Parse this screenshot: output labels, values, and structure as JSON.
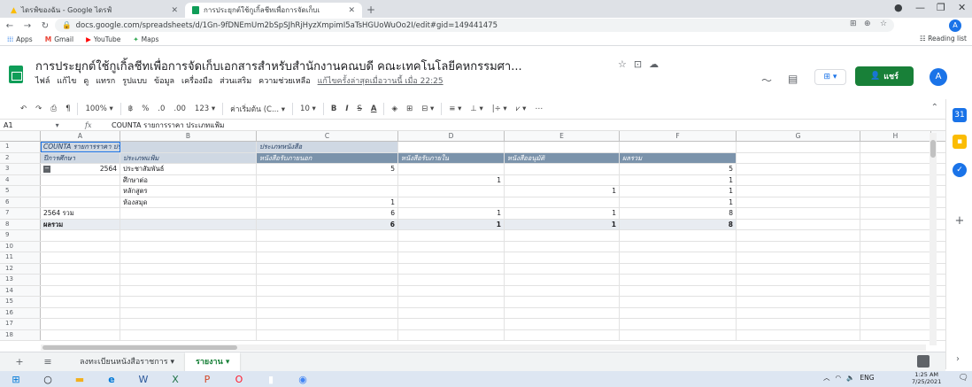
{
  "browser": {
    "tabs": [
      {
        "title": "ไดรฟ์ของฉัน - Google ไดรฟ์",
        "icon": "google-drive-icon",
        "color": "#fbbc04"
      },
      {
        "title": "การประยุกต์ใช้กูเกิ้ลชีทเพื่อการจัดเก็บเ",
        "icon": "google-sheets-icon",
        "color": "#0f9d58"
      }
    ],
    "new_tab": "+",
    "minimize": "—",
    "maximize": "❐",
    "close": "✕",
    "url": "docs.google.com/spreadsheets/d/1Gn-9fDNEmUm2bSpSJhRjHyzXmpimI5aTsHGUoWuOo2I/edit#gid=149441475",
    "profile": "A",
    "bookmarks": [
      "Apps",
      "Gmail",
      "YouTube",
      "Maps"
    ],
    "reading_list": "Reading list"
  },
  "sheets": {
    "title": "การประยุกต์ใช้กูเกิ้ลชีทเพื่อการจัดเก็บเอกสารสำหรับสำนักงานคณบดี คณะเทคโนโลยีคหกรรมศา...",
    "menus": [
      "ไฟล์",
      "แก้ไข",
      "ดู",
      "แทรก",
      "รูปแบบ",
      "ข้อมูล",
      "เครื่องมือ",
      "ส่วนเสริม",
      "ความช่วยเหลือ"
    ],
    "last_edit": "แก้ไขครั้งล่าสุดเมื่อวานนี้ เมื่อ 22:25",
    "share_label": "แชร์",
    "account": "A",
    "present_label": "⊞ ▾",
    "accent": "#188038"
  },
  "toolbar": {
    "zoom": "100%",
    "currency": "฿",
    "percent": "%",
    "decimal_decrease": ".0",
    "decimal_increase": ".00",
    "number_format": "123",
    "font": "ค่าเริ่มต้น (C...",
    "font_size": "10",
    "more": "⋯"
  },
  "formula_bar": {
    "cell_ref": "A1",
    "fx": "fx",
    "content": "COUNTA รายการราคา ประเภทแฟ้ม"
  },
  "grid": {
    "columns": [
      "A",
      "B",
      "C",
      "D",
      "E",
      "F",
      "G",
      "H"
    ],
    "rows": [
      [
        "COUNTA รายการราคา ประเภทแฟ้ม",
        "",
        "ประเภทหนังสือ",
        "",
        "",
        "",
        "",
        ""
      ],
      [
        "ปีการศึกษา",
        "ประเภทแฟ้ม",
        "หนังสือรับภายนอก",
        "หนังสือรับภายใน",
        "หนังสืออนุมัติ",
        "ผลรวม",
        "",
        ""
      ],
      [
        "2564",
        "ประชาสัมพันธ์",
        "5",
        "",
        "",
        "5",
        "",
        ""
      ],
      [
        "",
        "ศึกษาต่อ",
        "",
        "1",
        "",
        "1",
        "",
        ""
      ],
      [
        "",
        "หลักสูตร",
        "",
        "",
        "1",
        "1",
        "",
        ""
      ],
      [
        "",
        "ห้องสมุด",
        "1",
        "",
        "",
        "1",
        "",
        ""
      ],
      [
        "2564 รวม",
        "",
        "6",
        "1",
        "1",
        "8",
        "",
        ""
      ],
      [
        "ผลรวม",
        "",
        "6",
        "1",
        "1",
        "8",
        "",
        ""
      ],
      [
        "",
        "",
        "",
        "",
        "",
        "",
        "",
        ""
      ],
      [
        "",
        "",
        "",
        "",
        "",
        "",
        "",
        ""
      ],
      [
        "",
        "",
        "",
        "",
        "",
        "",
        "",
        ""
      ],
      [
        "",
        "",
        "",
        "",
        "",
        "",
        "",
        ""
      ],
      [
        "",
        "",
        "",
        "",
        "",
        "",
        "",
        ""
      ],
      [
        "",
        "",
        "",
        "",
        "",
        "",
        "",
        ""
      ],
      [
        "",
        "",
        "",
        "",
        "",
        "",
        "",
        ""
      ],
      [
        "",
        "",
        "",
        "",
        "",
        "",
        "",
        ""
      ],
      [
        "",
        "",
        "",
        "",
        "",
        "",
        "",
        ""
      ],
      [
        "",
        "",
        "",
        "",
        "",
        "",
        "",
        ""
      ]
    ],
    "row_numbers": [
      "1",
      "2",
      "3",
      "4",
      "5",
      "6",
      "7",
      "8",
      "9",
      "10",
      "11",
      "12",
      "13",
      "14",
      "15",
      "16",
      "17",
      "18"
    ]
  },
  "sheet_tabs": {
    "add": "+",
    "list": "≡",
    "tabs": [
      "ลงทะเบียนหนังสือราชการ",
      "รายงาน"
    ],
    "active_index": 1
  },
  "taskbar": {
    "lang": "ENG",
    "time": "1:25 AM",
    "date": "7/25/2021"
  }
}
